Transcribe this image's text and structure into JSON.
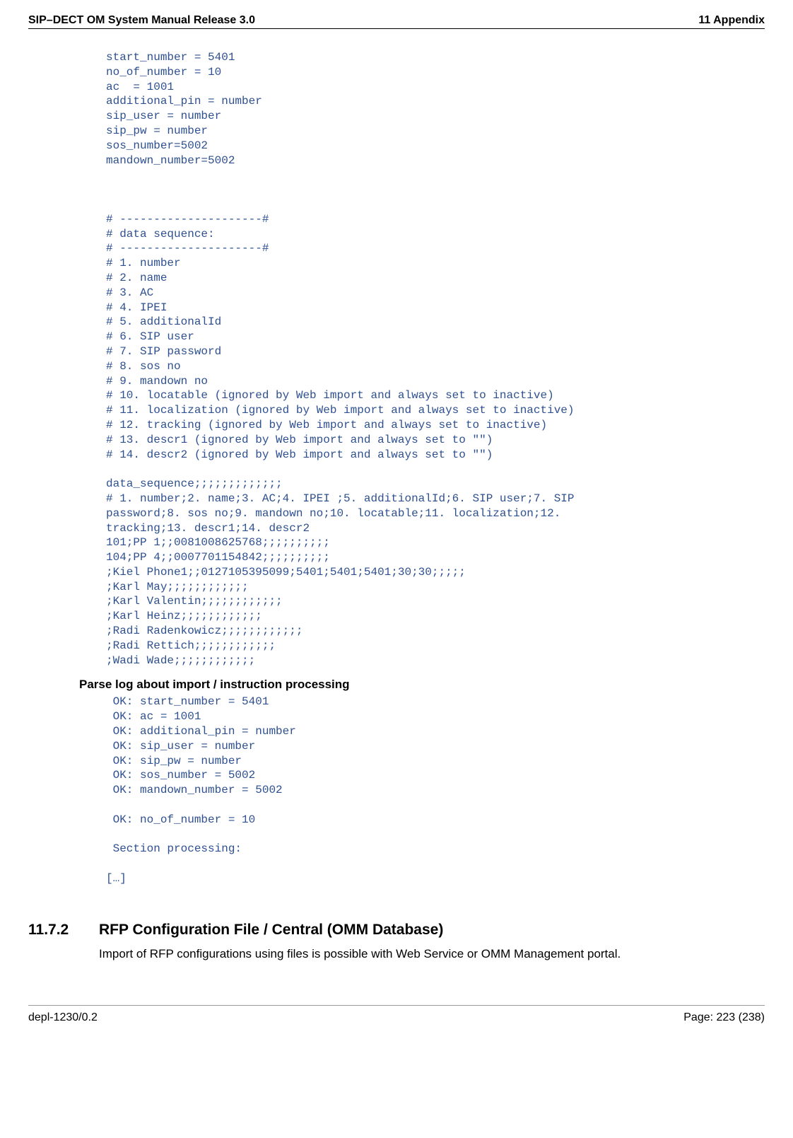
{
  "header": {
    "left": "SIP–DECT OM System Manual Release 3.0",
    "right": "11 Appendix"
  },
  "footer": {
    "left": "depl-1230/0.2",
    "right": "Page: 223 (238)"
  },
  "code1": "start_number = 5401\nno_of_number = 10\nac  = 1001\nadditional_pin = number\nsip_user = number\nsip_pw = number\nsos_number=5002\nmandown_number=5002\n\n\n\n# ---------------------#\n# data sequence:\n# ---------------------#\n# 1. number\n# 2. name\n# 3. AC\n# 4. IPEI\n# 5. additionalId\n# 6. SIP user\n# 7. SIP password\n# 8. sos no\n# 9. mandown no\n# 10. locatable (ignored by Web import and always set to inactive)\n# 11. localization (ignored by Web import and always set to inactive)\n# 12. tracking (ignored by Web import and always set to inactive)\n# 13. descr1 (ignored by Web import and always set to \"\")\n# 14. descr2 (ignored by Web import and always set to \"\")\n\ndata_sequence;;;;;;;;;;;;;\n# 1. number;2. name;3. AC;4. IPEI ;5. additionalId;6. SIP user;7. SIP\npassword;8. sos no;9. mandown no;10. locatable;11. localization;12.\ntracking;13. descr1;14. descr2\n101;PP 1;;0081008625768;;;;;;;;;;\n104;PP 4;;0007701154842;;;;;;;;;;\n;Kiel Phone1;;0127105395099;5401;5401;5401;30;30;;;;;\n;Karl May;;;;;;;;;;;;\n;Karl Valentin;;;;;;;;;;;;\n;Karl Heinz;;;;;;;;;;;;\n;Radi Radenkowicz;;;;;;;;;;;;\n;Radi Rettich;;;;;;;;;;;;\n;Wadi Wade;;;;;;;;;;;;",
  "parseTitle": "Parse log about import / instruction processing",
  "code2": " OK: start_number = 5401\n OK: ac = 1001\n OK: additional_pin = number\n OK: sip_user = number\n OK: sip_pw = number\n OK: sos_number = 5002\n OK: mandown_number = 5002\n\n OK: no_of_number = 10\n\n Section processing:\n\n[…]",
  "subsection": {
    "number": "11.7.2",
    "title": "RFP Configuration File / Central (OMM Database)",
    "text": "Import of RFP configurations using files is possible with Web Service or OMM Management portal."
  }
}
